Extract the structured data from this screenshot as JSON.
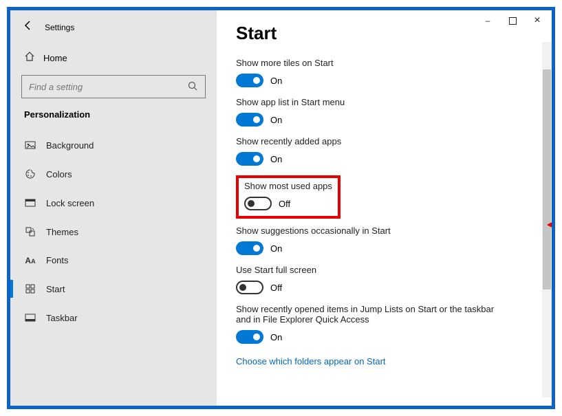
{
  "app": {
    "title": "Settings"
  },
  "colors": {
    "accent": "#0078d4",
    "highlight": "#e60000",
    "frame": "#0d62c7",
    "link": "#0067c0"
  },
  "window": {
    "minimize": "–",
    "close": "×"
  },
  "home": {
    "label": "Home"
  },
  "search": {
    "placeholder": "Find a setting"
  },
  "section": {
    "header": "Personalization"
  },
  "nav": {
    "items": [
      {
        "label": "Background",
        "icon": "image-icon"
      },
      {
        "label": "Colors",
        "icon": "palette-icon"
      },
      {
        "label": "Lock screen",
        "icon": "lockscreen-icon"
      },
      {
        "label": "Themes",
        "icon": "themes-icon"
      },
      {
        "label": "Fonts",
        "icon": "fonts-icon"
      },
      {
        "label": "Start",
        "icon": "start-icon"
      },
      {
        "label": "Taskbar",
        "icon": "taskbar-icon"
      }
    ]
  },
  "page": {
    "title": "Start"
  },
  "settings": [
    {
      "label": "Show more tiles on Start",
      "state": "On",
      "on": true
    },
    {
      "label": "Show app list in Start menu",
      "state": "On",
      "on": true
    },
    {
      "label": "Show recently added apps",
      "state": "On",
      "on": true
    },
    {
      "label": "Show most used apps",
      "state": "Off",
      "on": false,
      "highlighted": true
    },
    {
      "label": "Show suggestions occasionally in Start",
      "state": "On",
      "on": true
    },
    {
      "label": "Use Start full screen",
      "state": "Off",
      "on": false
    },
    {
      "label": "Show recently opened items in Jump Lists on Start or the taskbar and in File Explorer Quick Access",
      "state": "On",
      "on": true
    }
  ],
  "footer_link": {
    "label": "Choose which folders appear on Start"
  }
}
